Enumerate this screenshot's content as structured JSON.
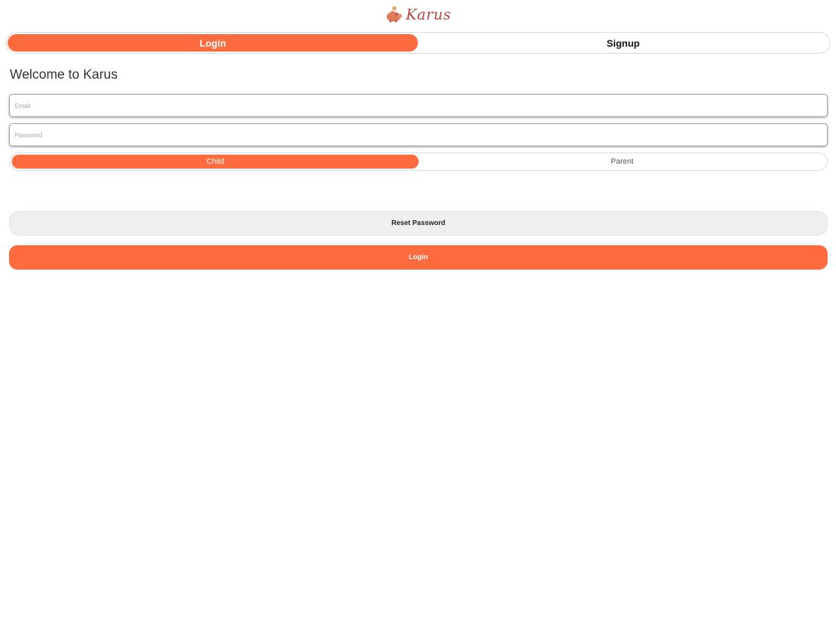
{
  "app": {
    "logo_text": "Karus",
    "logo_icon": "piggy-bank-icon"
  },
  "main_tabs": [
    {
      "label": "Login",
      "active": true
    },
    {
      "label": "Signup",
      "active": false
    }
  ],
  "welcome": "Welcome to Karus",
  "form": {
    "email_placeholder": "Email",
    "email_value": "",
    "password_placeholder": "Password",
    "password_value": ""
  },
  "role_tabs": [
    {
      "label": "Child",
      "active": true
    },
    {
      "label": "Parent",
      "active": false
    }
  ],
  "buttons": {
    "reset_label": "Reset Password",
    "login_label": "Login"
  },
  "colors": {
    "accent": "#fd6b3e",
    "logo": "#b24a4a",
    "secondary_button": "#efeff1"
  }
}
